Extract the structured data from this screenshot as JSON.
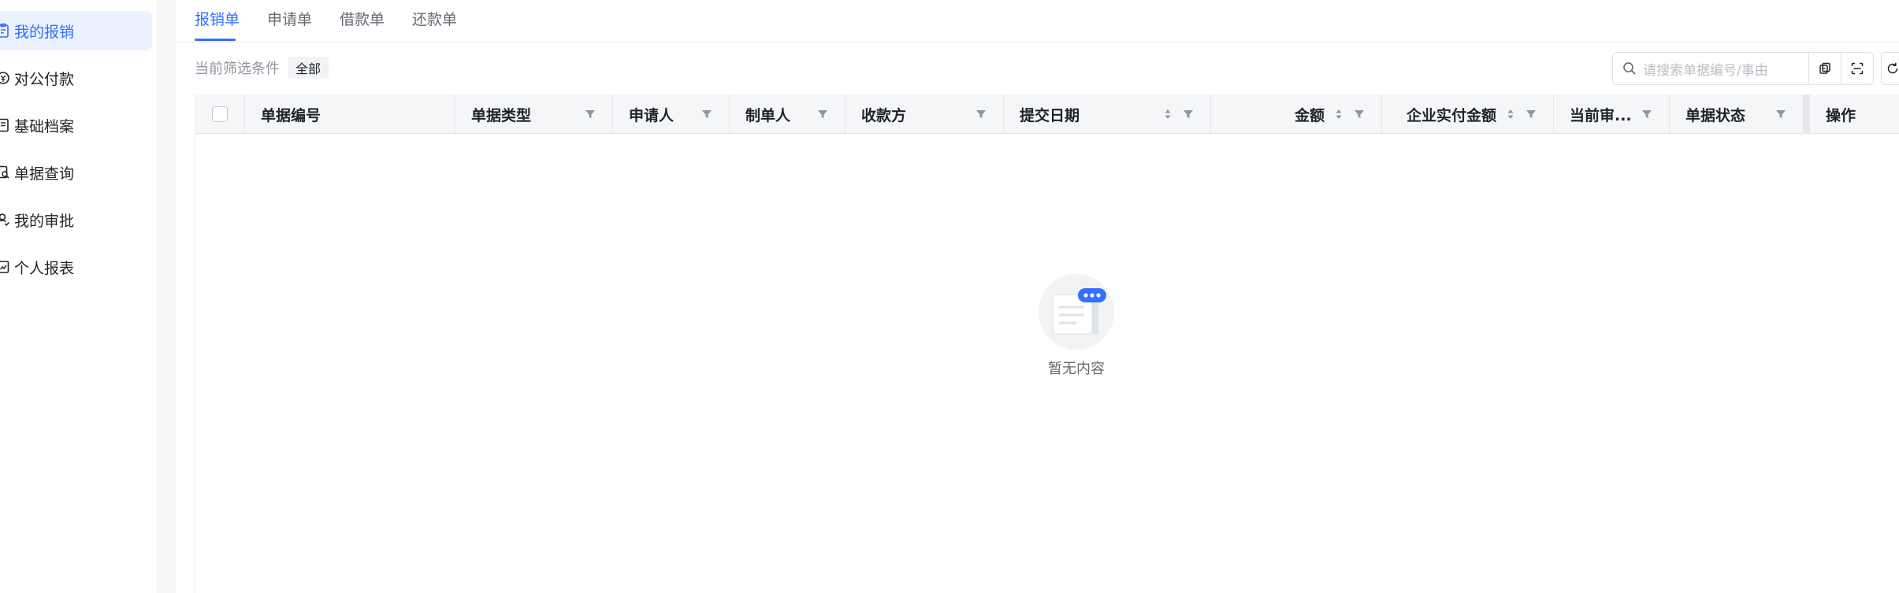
{
  "sidebar": {
    "items": [
      {
        "label": "我的报销",
        "icon": "clipboard-icon",
        "active": true
      },
      {
        "label": "对公付款",
        "icon": "payment-icon",
        "active": false
      },
      {
        "label": "基础档案",
        "icon": "archive-icon",
        "active": false
      },
      {
        "label": "单据查询",
        "icon": "search-doc-icon",
        "active": false
      },
      {
        "label": "我的审批",
        "icon": "approval-icon",
        "active": false
      },
      {
        "label": "个人报表",
        "icon": "report-icon",
        "active": false
      }
    ]
  },
  "tabs": [
    {
      "label": "报销单",
      "active": true
    },
    {
      "label": "申请单",
      "active": false
    },
    {
      "label": "借款单",
      "active": false
    },
    {
      "label": "还款单",
      "active": false
    }
  ],
  "filter": {
    "label": "当前筛选条件",
    "tag": "全部"
  },
  "search": {
    "placeholder": "请搜索单据编号/事由"
  },
  "table": {
    "columns": [
      {
        "label": "单据编号",
        "sortable": false,
        "filterable": false
      },
      {
        "label": "单据类型",
        "sortable": false,
        "filterable": true
      },
      {
        "label": "申请人",
        "sortable": false,
        "filterable": true
      },
      {
        "label": "制单人",
        "sortable": false,
        "filterable": true
      },
      {
        "label": "收款方",
        "sortable": false,
        "filterable": true
      },
      {
        "label": "提交日期",
        "sortable": true,
        "filterable": true
      },
      {
        "label": "金额",
        "sortable": true,
        "filterable": true
      },
      {
        "label": "企业实付金额",
        "sortable": true,
        "filterable": true
      },
      {
        "label": "当前审...",
        "sortable": false,
        "filterable": true
      },
      {
        "label": "单据状态",
        "sortable": false,
        "filterable": true
      },
      {
        "label": "操作",
        "sortable": false,
        "filterable": false
      }
    ],
    "rows": []
  },
  "empty_state": {
    "text": "暂无内容"
  },
  "colors": {
    "accent": "#3370ff",
    "active_bg": "#eaf1ff",
    "header_bg": "#f5f6f8",
    "text": "#1f2329",
    "muted": "#8f959e"
  }
}
